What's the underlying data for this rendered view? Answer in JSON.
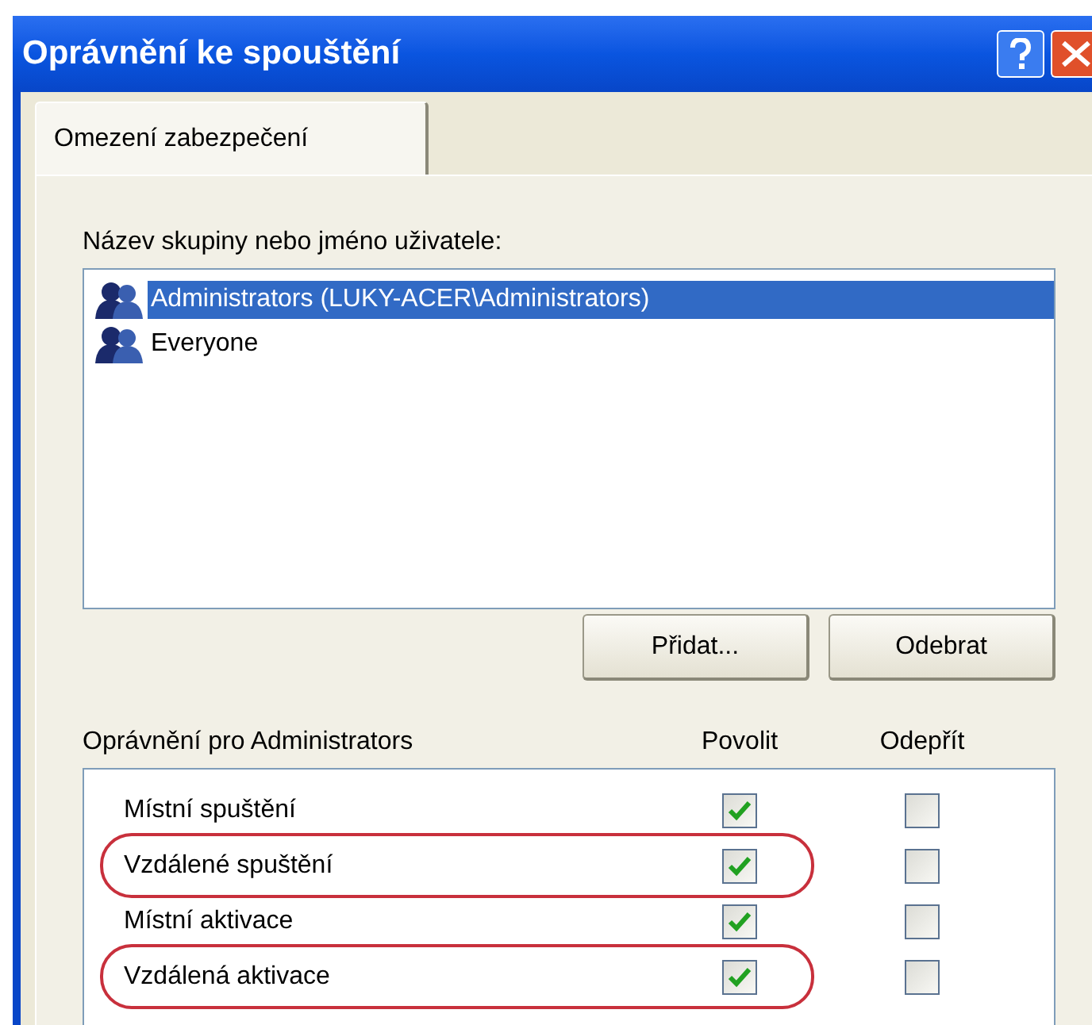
{
  "window": {
    "title": "Oprávnění ke spouštění"
  },
  "tabs": [
    {
      "label": "Omezení zabezpečení",
      "selected": true
    }
  ],
  "users_label": "Název skupiny nebo jméno uživatele:",
  "users": [
    {
      "name": "Administrators (LUKY-ACER\\Administrators)",
      "selected": true
    },
    {
      "name": "Everyone",
      "selected": false
    }
  ],
  "buttons": [
    "Přidat...",
    "Odebrat"
  ],
  "permissions_header": {
    "label": "Oprávnění pro Administrators",
    "column_allow": "Povolit",
    "column_deny": "Odepřít"
  },
  "permissions": [
    {
      "name": "Místní spuštění",
      "allow": true,
      "deny": false,
      "highlighted": false
    },
    {
      "name": "Vzdálené spuštění",
      "allow": true,
      "deny": false,
      "highlighted": true
    },
    {
      "name": "Místní aktivace",
      "allow": true,
      "deny": false,
      "highlighted": false
    },
    {
      "name": "Vzdálená aktivace",
      "allow": true,
      "deny": false,
      "highlighted": true
    }
  ]
}
